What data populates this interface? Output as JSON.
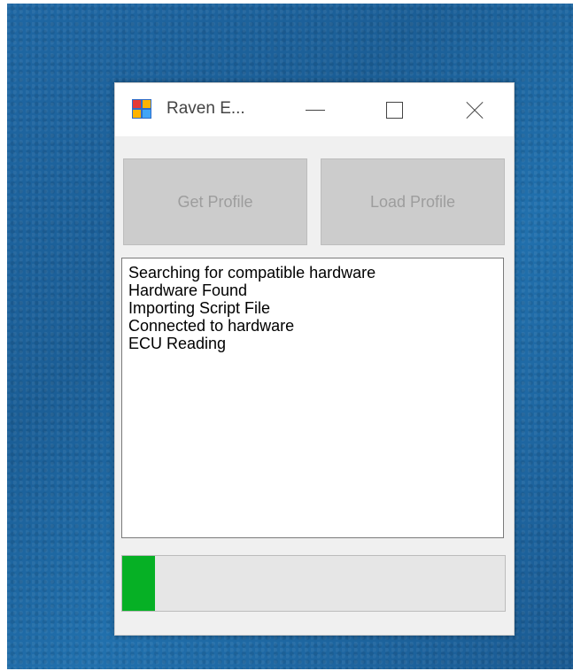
{
  "window": {
    "title": "Raven E...",
    "app_icon": "app-window-icon",
    "controls": {
      "minimize_icon": "minimize-icon",
      "maximize_icon": "maximize-icon",
      "close_icon": "close-icon"
    }
  },
  "buttons": {
    "get_profile": "Get Profile",
    "load_profile": "Load Profile"
  },
  "log": {
    "lines": [
      "Searching for compatible hardware",
      "Hardware Found",
      "Importing Script File",
      "Connected to hardware",
      "ECU Reading"
    ]
  },
  "progress": {
    "fraction": 0.085,
    "color": "#06b025"
  }
}
